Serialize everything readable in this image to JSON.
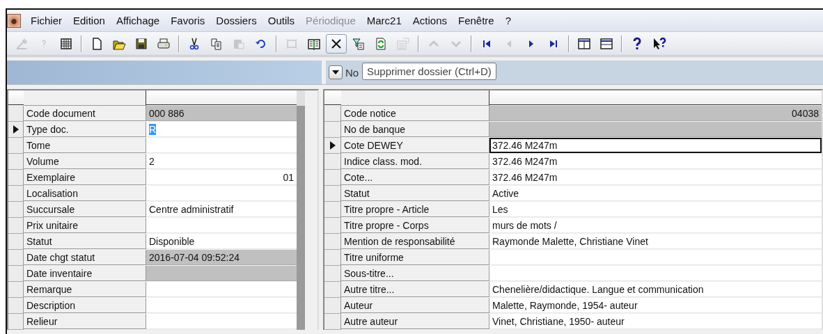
{
  "app_icon": true,
  "menu": [
    {
      "label": "Fichier",
      "disabled": false
    },
    {
      "label": "Edition",
      "disabled": false
    },
    {
      "label": "Affichage",
      "disabled": false
    },
    {
      "label": "Favoris",
      "disabled": false
    },
    {
      "label": "Dossiers",
      "disabled": false
    },
    {
      "label": "Outils",
      "disabled": false
    },
    {
      "label": "Périodique",
      "disabled": true
    },
    {
      "label": "Marc21",
      "disabled": false
    },
    {
      "label": "Actions",
      "disabled": false
    },
    {
      "label": "Fenêtre",
      "disabled": false
    },
    {
      "label": "?",
      "disabled": false
    }
  ],
  "toolbar": [
    {
      "kind": "button",
      "disabled": true,
      "pressed": false
    },
    {
      "kind": "button",
      "disabled": true,
      "pressed": false
    },
    {
      "kind": "button",
      "disabled": false,
      "pressed": false
    },
    {
      "kind": "separator"
    },
    {
      "kind": "button",
      "disabled": false,
      "pressed": false
    },
    {
      "kind": "button",
      "disabled": false,
      "pressed": false
    },
    {
      "kind": "button",
      "disabled": false,
      "pressed": false
    },
    {
      "kind": "button",
      "disabled": false,
      "pressed": false
    },
    {
      "kind": "separator"
    },
    {
      "kind": "button",
      "disabled": false,
      "pressed": false
    },
    {
      "kind": "button",
      "disabled": false,
      "pressed": false
    },
    {
      "kind": "button",
      "disabled": true,
      "pressed": false
    },
    {
      "kind": "button",
      "disabled": false,
      "pressed": false
    },
    {
      "kind": "separator"
    },
    {
      "kind": "button",
      "disabled": true,
      "pressed": false
    },
    {
      "kind": "button",
      "disabled": false,
      "pressed": false
    },
    {
      "kind": "button",
      "disabled": false,
      "pressed": true
    },
    {
      "kind": "button",
      "disabled": false,
      "pressed": false
    },
    {
      "kind": "button",
      "disabled": false,
      "pressed": false
    },
    {
      "kind": "button",
      "disabled": true,
      "pressed": false
    },
    {
      "kind": "separator"
    },
    {
      "kind": "button",
      "disabled": true,
      "pressed": false
    },
    {
      "kind": "button",
      "disabled": true,
      "pressed": false
    },
    {
      "kind": "separator"
    },
    {
      "kind": "button",
      "disabled": false,
      "pressed": false
    },
    {
      "kind": "button",
      "disabled": true,
      "pressed": false
    },
    {
      "kind": "button",
      "disabled": false,
      "pressed": false
    },
    {
      "kind": "button",
      "disabled": false,
      "pressed": false
    },
    {
      "kind": "separator"
    },
    {
      "kind": "button",
      "disabled": false,
      "pressed": false
    },
    {
      "kind": "button",
      "disabled": false,
      "pressed": false
    },
    {
      "kind": "separator"
    },
    {
      "kind": "button",
      "disabled": false,
      "pressed": false
    },
    {
      "kind": "button",
      "disabled": false,
      "pressed": false
    }
  ],
  "right_header": {
    "label": "No",
    "tooltip": "Supprimer dossier (Ctrl+D)"
  },
  "left_grid": {
    "rows": [
      {
        "label": "Code document",
        "value": "000 886",
        "readonly": true,
        "current": false,
        "kind": "text"
      },
      {
        "label": "Type doc.",
        "value": "R",
        "readonly": false,
        "current": true,
        "kind": "text"
      },
      {
        "label": "Tome",
        "readonly": false,
        "current": false,
        "kind": "text"
      },
      {
        "label": "Volume",
        "value": "2",
        "readonly": false,
        "current": false,
        "kind": "text"
      },
      {
        "label": "Exemplaire",
        "value": "01",
        "readonly": false,
        "current": false,
        "kind": "number"
      },
      {
        "label": "Localisation",
        "readonly": false,
        "current": false,
        "kind": "text"
      },
      {
        "label": "Succursale",
        "value": "Centre administratif",
        "readonly": false,
        "current": false,
        "kind": "text"
      },
      {
        "label": "Prix unitaire",
        "readonly": false,
        "current": false,
        "kind": "text"
      },
      {
        "label": "Statut",
        "value": "Disponible",
        "readonly": false,
        "current": false,
        "kind": "text"
      },
      {
        "label": "Date chgt statut",
        "value": "2016-07-04 09:52:24",
        "readonly": true,
        "current": false,
        "kind": "text"
      },
      {
        "label": "Date inventaire",
        "readonly": true,
        "current": false,
        "kind": "text"
      },
      {
        "label": "Remarque",
        "readonly": false,
        "current": false,
        "kind": "text"
      },
      {
        "label": "Description",
        "readonly": false,
        "current": false,
        "kind": "text"
      },
      {
        "label": "Relieur",
        "readonly": false,
        "current": false,
        "kind": "text"
      }
    ]
  },
  "right_grid": {
    "rows": [
      {
        "label": "Code notice",
        "value": "04038",
        "readonly": true,
        "current": false,
        "kind": "number"
      },
      {
        "label": "No de banque",
        "readonly": true,
        "current": false,
        "kind": "text"
      },
      {
        "label": "Cote DEWEY",
        "value": "372.46 M247m",
        "readonly": false,
        "current": true,
        "kind": "text"
      },
      {
        "label": "Indice class. mod.",
        "value": "372.46 M247m",
        "readonly": false,
        "current": false,
        "kind": "text"
      },
      {
        "label": "Cote...",
        "value": "372.46 M247m",
        "readonly": false,
        "current": false,
        "kind": "text"
      },
      {
        "label": "Statut",
        "value": "Active",
        "readonly": false,
        "current": false,
        "kind": "text"
      },
      {
        "label": "Titre propre - Article",
        "value": "Les",
        "readonly": false,
        "current": false,
        "kind": "text"
      },
      {
        "label": "Titre propre - Corps",
        "value": "murs de mots /",
        "readonly": false,
        "current": false,
        "kind": "text"
      },
      {
        "label": "Mention de responsabilité",
        "value": "Raymonde Malette, Christiane Vinet",
        "readonly": false,
        "current": false,
        "kind": "text"
      },
      {
        "label": "Titre uniforme",
        "readonly": false,
        "current": false,
        "kind": "text"
      },
      {
        "label": "Sous-titre...",
        "readonly": false,
        "current": false,
        "kind": "text"
      },
      {
        "label": "Autre titre...",
        "value": "Chenelière/didactique. Langue et communication",
        "readonly": false,
        "current": false,
        "kind": "text"
      },
      {
        "label": "Auteur",
        "value": "Malette, Raymonde, 1954- auteur",
        "readonly": false,
        "current": false,
        "kind": "text"
      },
      {
        "label": "Autre auteur",
        "value": "Vinet, Christiane, 1950- auteur",
        "readonly": false,
        "current": false,
        "kind": "text"
      }
    ]
  }
}
